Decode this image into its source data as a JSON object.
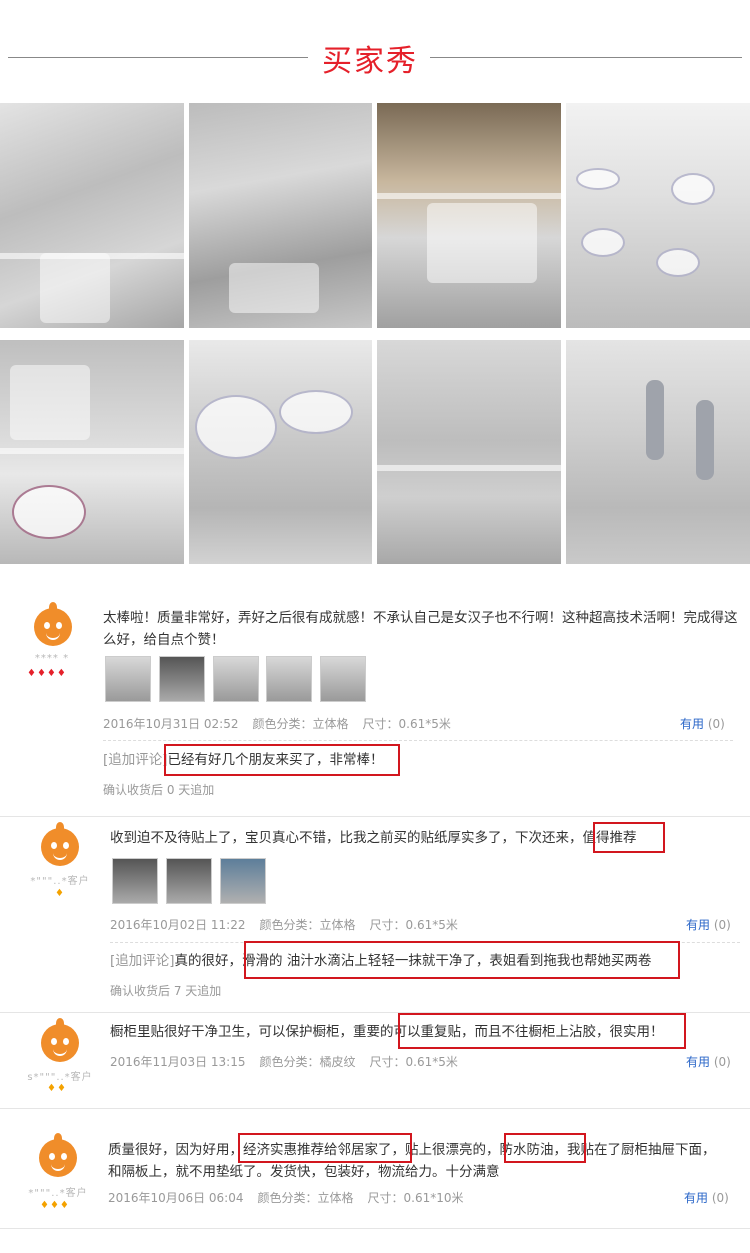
{
  "header": {
    "title": "买家秀"
  },
  "reviews": [
    {
      "user": "**** *",
      "text": "太棒啦！质量非常好，弄好之后很有成就感！不承认自己是女汉子也不行啊！这种超高技术活啊！完成得这么好，给自点个赞！",
      "date": "2016年10月31日 02:52",
      "color": "颜色分类：立体格",
      "size": "尺寸：0.61*5米",
      "useful_label": "有用",
      "useful_count": "(0)",
      "add_tag": "[追加评论]",
      "add_text": "已经有好几个朋友来买了，非常棒！",
      "add_note": "确认收货后 0 天追加"
    },
    {
      "user": "*\"\"\"..*客户",
      "text_line1": "收到迫不及待贴上了，宝贝真心不错，比我之前买的贴纸厚实多了，下次还来，",
      "text_tail": "值得推荐",
      "date": "2016年10月02日 11:22",
      "color": "颜色分类：立体格",
      "size": "尺寸：0.61*5米",
      "useful_label": "有用",
      "useful_count": "(0)",
      "add_tag": "[追加评论]",
      "add_text": "真的很好，滑滑的 油汁水滴沾上轻轻一抹就干净了，表姐看到拖我也帮她买两卷",
      "add_note": "确认收货后 7 天追加"
    },
    {
      "user": "s*\"\"\"..*客户",
      "text": "橱柜里贴很好干净卫生，可以保护橱柜，重要的可以重复贴，而且不往橱柜上沾胶，很实用！",
      "date": "2016年11月03日 13:15",
      "color": "颜色分类：橘皮纹",
      "size": "尺寸：0.61*5米",
      "useful_label": "有用",
      "useful_count": "(0)"
    },
    {
      "user": "*\"\"\"..*客户",
      "text_line1": "质量很好，因为好用，经济实惠推荐给邻居家了，贴上很漂亮的，防水防油，我贴在了厨柜抽屉下面，",
      "text_line2": "和隔板上，就不用垫纸了。发货快，包装好，物流给力。十分满意",
      "date": "2016年10月06日 06:04",
      "color": "颜色分类：立体格",
      "size": "尺寸：0.61*10米",
      "useful_label": "有用",
      "useful_count": "(0)"
    }
  ],
  "colors": {
    "accent": "#e5202a",
    "link": "#2a66c8",
    "highlight_box": "#d2161e"
  }
}
